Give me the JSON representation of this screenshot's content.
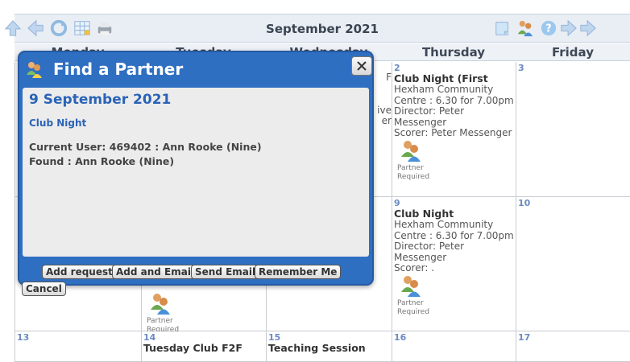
{
  "calendar": {
    "month_title": "September 2021",
    "day_names": [
      "Monday",
      "Tuesday",
      "Wednesday",
      "Thursday",
      "Friday"
    ],
    "toolbar_icons": [
      "up-arrow-icon",
      "back-arrow-icon",
      "refresh-icon",
      "calendar-grid-icon",
      "printer-icon",
      "notepad-icon",
      "find-partner-icon",
      "help-icon",
      "forward-arrow-icon",
      "forward-arrow-icon"
    ],
    "week1": {
      "wed_fragments": [
        "F",
        "",
        "",
        "ive",
        "er"
      ],
      "thu": {
        "day": "2",
        "title": "Club Night (First",
        "lines": [
          "Hexham Community",
          "Centre : 6.30 for 7.00pm",
          "Director: Peter",
          "Messenger",
          "Scorer: Peter Messenger"
        ],
        "partner_label": "Partner Required"
      },
      "fri_day": "3"
    },
    "week2": {
      "tue_partner_label": "Partner Required",
      "thu": {
        "day": "9",
        "title": "Club Night",
        "lines": [
          "Hexham Community",
          "Centre : 6.30 for 7.00pm",
          "Director: Peter",
          "Messenger",
          "Scorer: ."
        ],
        "partner_label": "Partner Required"
      },
      "fri_day": "10"
    },
    "week3": {
      "mon_day": "13",
      "tue_day": "14",
      "tue_title": "Tuesday Club F2F",
      "wed_day": "15",
      "wed_title": "Teaching Session",
      "thu_day": "16",
      "fri_day": "17"
    }
  },
  "dialog": {
    "title": "Find a Partner",
    "date": "9 September 2021",
    "event": "Club Night",
    "current_user": "Current User: 469402 : Ann Rooke (Nine)",
    "found": "Found : Ann Rooke (Nine)",
    "buttons": {
      "add_request": "Add request",
      "add_and_email": "Add and Email",
      "send_email": "Send Email",
      "remember_me": "Remember Me",
      "cancel": "Cancel"
    }
  },
  "colors": {
    "dialog_blue": "#2f6fc2",
    "date_text_blue": "#2a63b7",
    "day_number_blue": "#6b8bc0"
  }
}
